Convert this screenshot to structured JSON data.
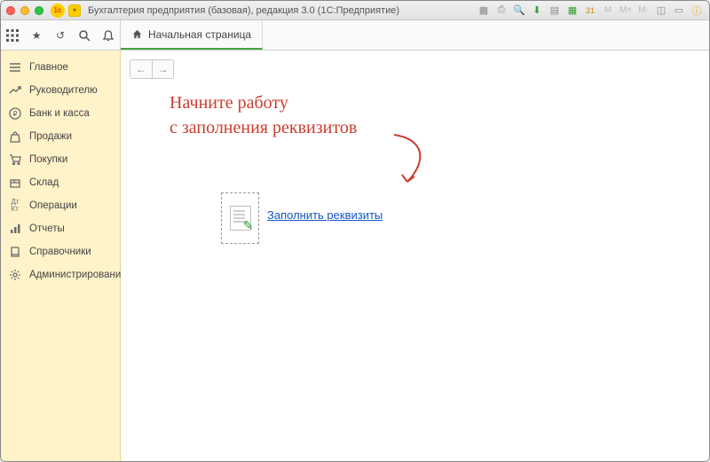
{
  "window_title": "Бухгалтерия предприятия (базовая), редакция 3.0  (1С:Предприятие)",
  "top_icons": {
    "apps": "apps",
    "favorites": "star",
    "history": "history",
    "search": "search",
    "bell": "bell"
  },
  "tab": {
    "label": "Начальная страница"
  },
  "sidebar": {
    "items": [
      {
        "icon": "menu",
        "label": "Главное"
      },
      {
        "icon": "chart-line",
        "label": "Руководителю"
      },
      {
        "icon": "ruble",
        "label": "Банк и касса"
      },
      {
        "icon": "bag",
        "label": "Продажи"
      },
      {
        "icon": "cart",
        "label": "Покупки"
      },
      {
        "icon": "box",
        "label": "Склад"
      },
      {
        "icon": "dtkt",
        "label": "Операции"
      },
      {
        "icon": "bars",
        "label": "Отчеты"
      },
      {
        "icon": "book",
        "label": "Справочники"
      },
      {
        "icon": "gear",
        "label": "Администрирование"
      }
    ]
  },
  "hint": {
    "line1": "Начните работу",
    "line2": "с заполнения реквизитов"
  },
  "action": {
    "link_text": "Заполнить реквизиты"
  },
  "titlebar_right": [
    "grid",
    "print",
    "search",
    "download",
    "calc",
    "calendar",
    "date",
    "M",
    "M+",
    "M-",
    "layout",
    "book",
    "info"
  ]
}
